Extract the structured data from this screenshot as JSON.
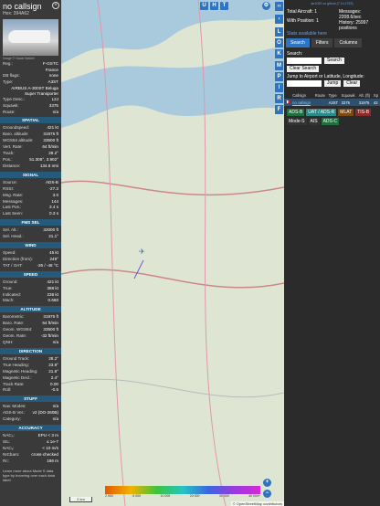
{
  "sidebar": {
    "callsign": "no callsign",
    "hex": "Hex: 394A62",
    "photo_credit": "Image © Naoki Wakiel",
    "reg_label": "Reg.:",
    "reg": "F-GSTC",
    "country": "France",
    "dbflags_label": "DB flags:",
    "dbflags": "none",
    "type_label": "Type:",
    "type": "A3ST",
    "type_full": "AIRBUS A-300ST Beluga Super Transporter",
    "typedesc_label": "Type Desc.:",
    "typedesc": "L2J",
    "squawk_label": "Squawk:",
    "squawk": "3375",
    "route_label": "Route:",
    "route": "n/a",
    "sections": {
      "spatial": "SPATIAL",
      "signal": "SIGNAL",
      "fms": "FMS SEL",
      "wind": "WIND",
      "speed": "SPEED",
      "altitude": "ALTITUDE",
      "direction": "DIRECTION",
      "stuff": "STUFF",
      "accuracy": "ACCURACY"
    },
    "spatial": [
      [
        "Groundspeed:",
        "421 kt"
      ],
      [
        "Baro. altitude:",
        "31975 ft"
      ],
      [
        "WGS84 altitude:",
        "33500 ft"
      ],
      [
        "Vert. Rate:",
        "64 ft/min"
      ],
      [
        "Track:",
        "28.2°"
      ],
      [
        "Pos.:",
        "51.306°, 3.902°"
      ],
      [
        "Distance:",
        "134.8 nmi"
      ]
    ],
    "signal": [
      [
        "Source:",
        "ADS-B"
      ],
      [
        "RSSI:",
        "-27.3"
      ],
      [
        "Msg. Rate:",
        "3.0"
      ],
      [
        "Messages:",
        "144"
      ],
      [
        "Last Pos.:",
        "3.4 s"
      ],
      [
        "Last Seen:",
        "0.3 s"
      ]
    ],
    "fms": [
      [
        "Sel. Alt.:",
        "32000 ft"
      ],
      [
        "Sel. Head.:",
        "21.1°"
      ]
    ],
    "wind": [
      [
        "Speed:",
        "45 kt"
      ],
      [
        "Direction (from):",
        "249°"
      ],
      [
        "TAT / OAT:",
        "-26 / -46 °C"
      ]
    ],
    "speed": [
      [
        "Ground:",
        "421 kt"
      ],
      [
        "True:",
        "388 kt"
      ],
      [
        "Indicated:",
        "236 kt"
      ],
      [
        "Mach:",
        "0.660"
      ]
    ],
    "altitude": [
      [
        "Barometric:",
        "31975 ft"
      ],
      [
        "Baro. Rate:",
        "64 ft/min"
      ],
      [
        "Geom. WGS84:",
        "33500 ft"
      ],
      [
        "Geom. Rate:",
        "-32 ft/min"
      ],
      [
        "QNH:",
        "n/a"
      ]
    ],
    "direction": [
      [
        "Ground Track:",
        "28.2°"
      ],
      [
        "True Heading:",
        "23.9°"
      ],
      [
        "Magnetic Heading:",
        "21.6°"
      ],
      [
        "Magnetic Decl.:",
        "2.4°"
      ],
      [
        "Track Rate:",
        "0.00"
      ],
      [
        "Roll:",
        "-0.5"
      ]
    ],
    "stuff": [
      [
        "Nav. Modes:",
        "n/a"
      ],
      [
        "ADS-B Ver.:",
        "v2 (DO-260B)"
      ],
      [
        "Category:",
        "n/a"
      ]
    ],
    "accuracy": [
      [
        "NACₚ:",
        "EPU < 3 m"
      ],
      [
        "SIL:",
        "≤ 1e-7"
      ],
      [
        "NACᵥ:",
        "< 10 m/s"
      ],
      [
        "NICbaro:",
        "cross-checked"
      ],
      [
        "Rc:",
        "186 m"
      ]
    ],
    "learn": "Learn more about Mode S data type by hovering over each data label."
  },
  "map": {
    "top_buttons": [
      "U",
      "H",
      "T"
    ],
    "side_buttons": [
      "L",
      "O",
      "K",
      "M",
      "P",
      "I",
      "R",
      "F"
    ],
    "scale": "2 km",
    "attribution": "© OpenStreetMap contributors",
    "altitude_ticks": [
      "2 000",
      "6 000",
      "10 000",
      "20 000",
      "30 000",
      "40 000+"
    ],
    "zoom_in": "+",
    "zoom_out": "−"
  },
  "panel": {
    "version_link": "tar1090 on github (7.14.1753)",
    "total_label": "Total Aircraft: 1",
    "messages_label": "Messages:",
    "messages_value": "2208.6/sec",
    "with_pos": "With Position: 1",
    "history": "History: 25997 positions",
    "stats_link": "Stats available here",
    "tabs": [
      "Search",
      "Filters",
      "Columns"
    ],
    "search_label": "Search:",
    "search_button": "Search",
    "clear_search": "Clear Search",
    "jump_label": "Jump to Airport or Latitude, Longitude:",
    "jump_button": "Jump",
    "clear_button": "Clear",
    "columns": [
      "",
      "Callsign",
      "Route",
      "Type",
      "Squawk",
      "Alt. (ft)",
      "Sp"
    ],
    "row": [
      "🇫🇷",
      "no callsign",
      "",
      "A3ST",
      "3375",
      "31975",
      "42"
    ],
    "tags": [
      "ADS-B",
      "UAT / ADS-R",
      "MLAT",
      "TIS-B",
      "Mode-S",
      "AIS",
      "ADS-C"
    ],
    "tag_colors": [
      "#1f6f3f",
      "#2a8a8a",
      "#7a4a14",
      "#8a2a2a",
      "#333",
      "#333",
      "#1f6f3f"
    ]
  }
}
